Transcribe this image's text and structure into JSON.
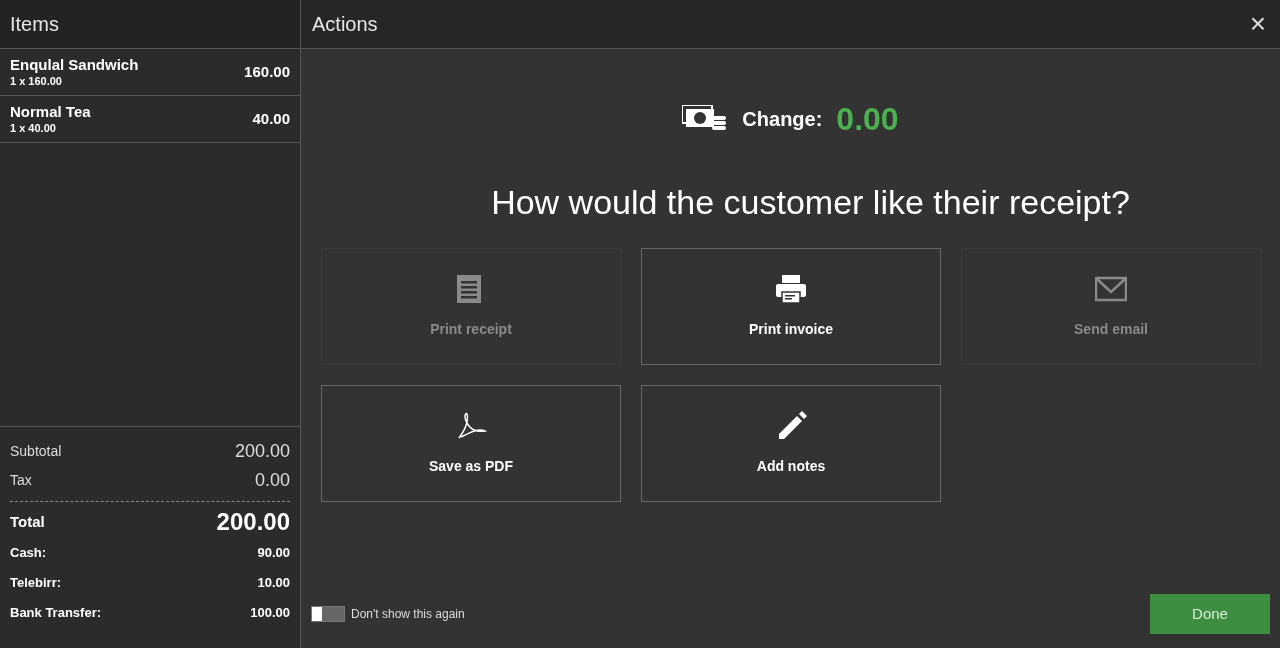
{
  "items_panel": {
    "title": "Items",
    "items": [
      {
        "name": "Enqulal Sandwich",
        "detail": "1 x 160.00",
        "amount": "160.00"
      },
      {
        "name": "Normal Tea",
        "detail": "1 x 40.00",
        "amount": "40.00"
      }
    ]
  },
  "summary": {
    "subtotal": {
      "label": "Subtotal",
      "value": "200.00"
    },
    "tax": {
      "label": "Tax",
      "value": "0.00"
    },
    "total": {
      "label": "Total",
      "value": "200.00"
    },
    "payments": [
      {
        "label": "Cash:",
        "value": "90.00"
      },
      {
        "label": "Telebirr:",
        "value": "10.00"
      },
      {
        "label": "Bank Transfer:",
        "value": "100.00"
      }
    ]
  },
  "actions_panel": {
    "title": "Actions",
    "close": "×",
    "change_label": "Change:",
    "change_value": "0.00",
    "question": "How would the customer like their receipt?",
    "options": [
      {
        "kind": "receipt",
        "label": "Print receipt",
        "disabled": true
      },
      {
        "kind": "printer",
        "label": "Print invoice",
        "disabled": false
      },
      {
        "kind": "email",
        "label": "Send email",
        "disabled": true
      },
      {
        "kind": "pdf",
        "label": "Save as PDF",
        "disabled": false
      },
      {
        "kind": "notes",
        "label": "Add notes",
        "disabled": false
      }
    ],
    "dont_show": {
      "label": "Don't show this again",
      "on": false
    },
    "done": "Done"
  }
}
